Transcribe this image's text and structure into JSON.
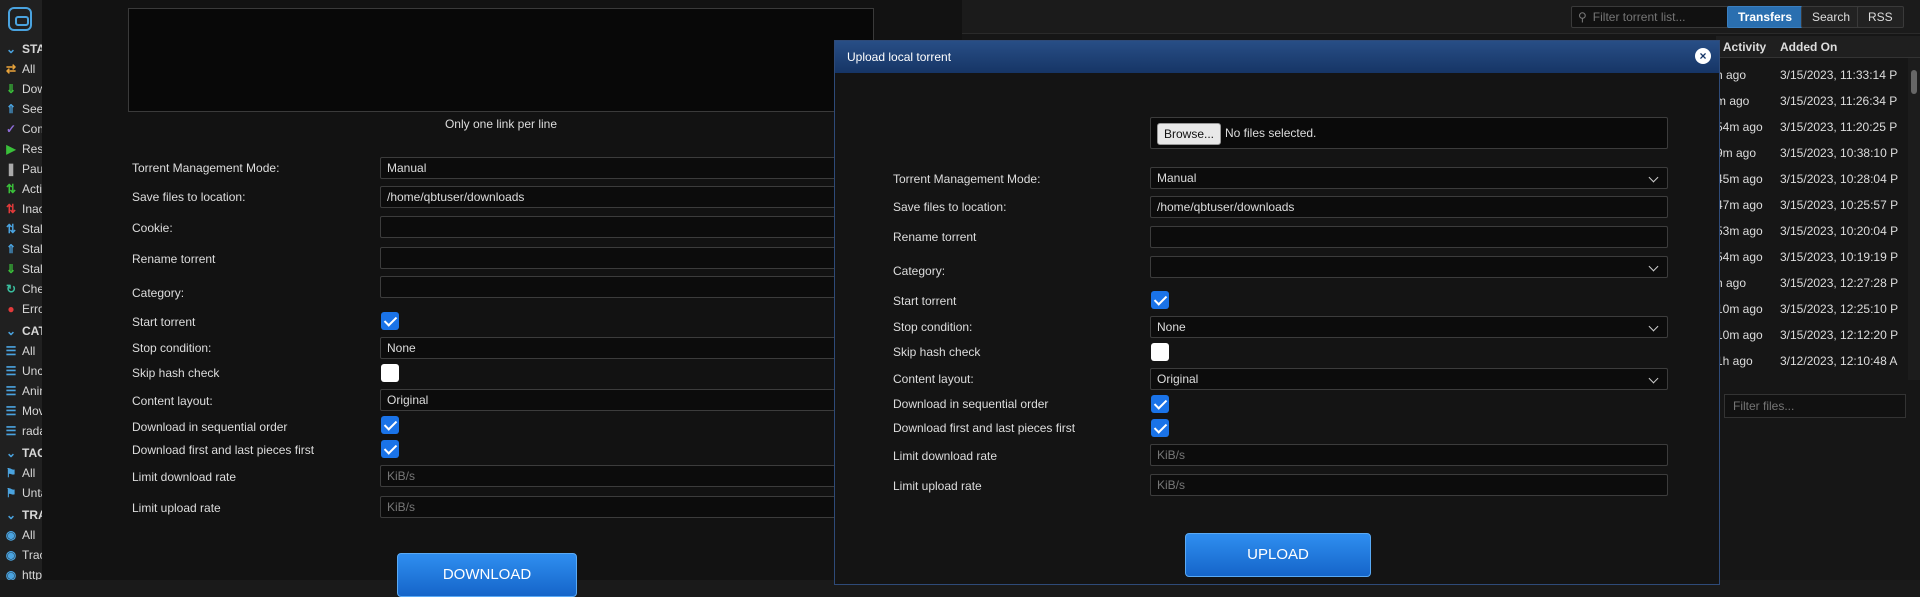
{
  "sidebar": {
    "status_header": "STATUS",
    "status_items": [
      "All",
      "Downloading",
      "Seeding",
      "Completed",
      "Resumed",
      "Paused",
      "Active",
      "Inactive",
      "Stalled",
      "Stalled Uploading",
      "Stalled Downloading",
      "Checking",
      "Errored"
    ],
    "categories_header": "CATEGORIES",
    "category_items": [
      "All",
      "Uncategorized",
      "Animation",
      "Movies",
      "radarr"
    ],
    "tags_header": "TAGS",
    "tag_items": [
      "All",
      "Untagged"
    ],
    "trackers_header": "TRACKERS",
    "tracker_items": [
      "All",
      "Trackerless",
      "http"
    ]
  },
  "toolbar": {
    "search_placeholder": "Filter torrent list...",
    "tabs": [
      "Transfers",
      "Search",
      "RSS"
    ]
  },
  "transfers": {
    "columns": [
      "t Activity",
      "Added On"
    ],
    "rows": [
      {
        "activity": "h ago",
        "added": "3/15/2023, 11:33:14 P"
      },
      {
        "activity": "m ago",
        "added": "3/15/2023, 11:26:34 P"
      },
      {
        "activity": "54m ago",
        "added": "3/15/2023, 11:20:25 P"
      },
      {
        "activity": "9m ago",
        "added": "3/15/2023, 10:38:10 P"
      },
      {
        "activity": "45m ago",
        "added": "3/15/2023, 10:28:04 P"
      },
      {
        "activity": "47m ago",
        "added": "3/15/2023, 10:25:57 P"
      },
      {
        "activity": "53m ago",
        "added": "3/15/2023, 10:20:04 P"
      },
      {
        "activity": "54m ago",
        "added": "3/15/2023, 10:19:19 P"
      },
      {
        "activity": "h ago",
        "added": "3/15/2023, 12:27:28 P"
      },
      {
        "activity": "10m ago",
        "added": "3/15/2023, 12:25:10 P"
      },
      {
        "activity": "10m ago",
        "added": "3/15/2023, 12:12:20 P"
      },
      {
        "activity": "1h ago",
        "added": "3/12/2023, 12:10:48 A"
      }
    ],
    "filter_files_placeholder": "Filter files..."
  },
  "download_dialog": {
    "url_hint": "Only one link per line",
    "labels": {
      "mode": "Torrent Management Mode:",
      "save": "Save files to location:",
      "cookie": "Cookie:",
      "rename": "Rename torrent",
      "category": "Category:",
      "start": "Start torrent",
      "stop": "Stop condition:",
      "skip": "Skip hash check",
      "layout": "Content layout:",
      "sequential": "Download in sequential order",
      "firstlast": "Download first and last pieces first",
      "dl_limit": "Limit download rate",
      "ul_limit": "Limit upload rate"
    },
    "values": {
      "mode": "Manual",
      "save": "/home/qbtuser/downloads",
      "stop": "None",
      "layout": "Original",
      "rate_placeholder": "KiB/s"
    },
    "button": "DOWNLOAD"
  },
  "upload_dialog": {
    "title": "Upload local torrent",
    "close": "×",
    "browse": "Browse...",
    "no_file": "No files selected.",
    "labels": {
      "mode": "Torrent Management Mode:",
      "save": "Save files to location:",
      "rename": "Rename torrent",
      "category": "Category:",
      "start": "Start torrent",
      "stop": "Stop condition:",
      "skip": "Skip hash check",
      "layout": "Content layout:",
      "sequential": "Download in sequential order",
      "firstlast": "Download first and last pieces first",
      "dl_limit": "Limit download rate",
      "ul_limit": "Limit upload rate"
    },
    "values": {
      "mode": "Manual",
      "save": "/home/qbtuser/downloads",
      "stop": "None",
      "layout": "Original",
      "rate_placeholder": "KiB/s"
    },
    "button": "UPLOAD"
  },
  "colors": {
    "accent": "#1a73e8",
    "title_bar": "#1f4a82"
  }
}
